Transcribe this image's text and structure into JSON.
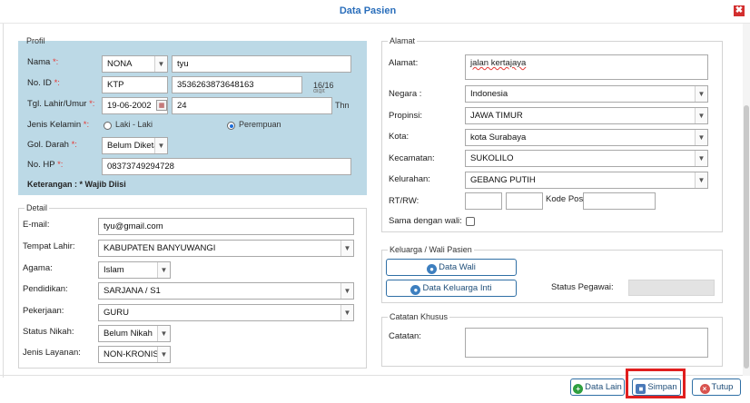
{
  "window": {
    "title": "Data Pasien",
    "close_symbol": "✖"
  },
  "profil": {
    "legend": "Profil",
    "nama_label": "Nama",
    "nama_prefix": "NONA",
    "nama_value": "tyu",
    "noid_label": "No. ID",
    "noid_type": "KTP",
    "noid_value": "3536263873648163",
    "noid_count": "16/16",
    "noid_count_unit": "digit",
    "tgl_label": "Tgl. Lahir/Umur",
    "tgl_value": "19-06-2002",
    "umur_value": "24",
    "umur_unit": "Thn",
    "jk_label": "Jenis Kelamin",
    "jk_opt1": "Laki - Laki",
    "jk_opt2": "Perempuan",
    "goldar_label": "Gol. Darah",
    "goldar_value": "Belum Diketa",
    "hp_label": "No. HP",
    "hp_value": "08373749294728",
    "keterangan": "Keterangan :",
    "wajib": "* Wajib Diisi",
    "req_mark": "*:"
  },
  "detail": {
    "legend": "Detail",
    "email_label": "E-mail:",
    "email_value": "tyu@gmail.com",
    "tempat_label": "Tempat Lahir:",
    "tempat_value": "KABUPATEN BANYUWANGI",
    "agama_label": "Agama:",
    "agama_value": "Islam",
    "pendidikan_label": "Pendidikan:",
    "pendidikan_value": "SARJANA / S1",
    "pekerjaan_label": "Pekerjaan:",
    "pekerjaan_value": "GURU",
    "nikah_label": "Status Nikah:",
    "nikah_value": "Belum Nikah",
    "layanan_label": "Jenis Layanan:",
    "layanan_value": "NON-KRONIS"
  },
  "alamat": {
    "legend": "Alamat",
    "alamat_label": "Alamat:",
    "alamat_value": "jalan kertajaya",
    "negara_label": "Negara :",
    "negara_value": "Indonesia",
    "propinsi_label": "Propinsi:",
    "propinsi_value": "JAWA TIMUR",
    "kota_label": "Kota:",
    "kota_value": "kota Surabaya",
    "kecamatan_label": "Kecamatan:",
    "kecamatan_value": "SUKOLILO",
    "kelurahan_label": "Kelurahan:",
    "kelurahan_value": "GEBANG PUTIH",
    "rtrw_label": "RT/RW:",
    "kodepos_label": "Kode Pos",
    "wali_label": "Sama dengan wali:"
  },
  "keluarga": {
    "legend": "Keluarga / Wali Pasien",
    "btn_wali": "Data Wali",
    "btn_keluarga": "Data Keluarga Inti",
    "status_pegawai": "Status Pegawai:"
  },
  "catatan": {
    "legend": "Catatan Khusus",
    "label": "Catatan:"
  },
  "footer": {
    "btn_lain": "Data Lain",
    "btn_simpan": "Simpan",
    "btn_tutup": "Tutup"
  }
}
